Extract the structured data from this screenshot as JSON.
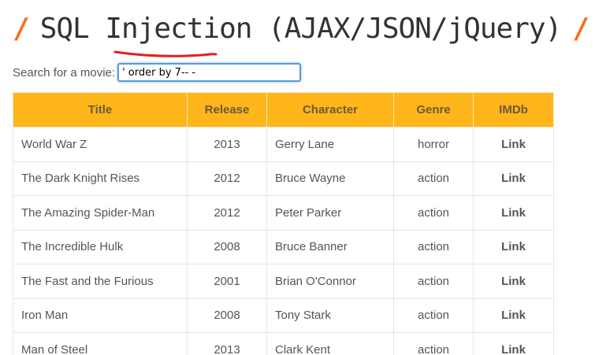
{
  "header": {
    "slash_left": "/",
    "title": "SQL Injection (AJAX/JSON/jQuery)",
    "slash_right": "/",
    "accent_color": "#ff6a14",
    "underline_color": "#e02020"
  },
  "search": {
    "label": "Search for a movie:",
    "value": "' order by 7-- -"
  },
  "table": {
    "header_color": "#ffb61a",
    "columns": [
      "Title",
      "Release",
      "Character",
      "Genre",
      "IMDb"
    ],
    "rows": [
      {
        "title": "World War Z",
        "release": "2013",
        "character": "Gerry Lane",
        "genre": "horror",
        "imdb": "Link"
      },
      {
        "title": "The Dark Knight Rises",
        "release": "2012",
        "character": "Bruce Wayne",
        "genre": "action",
        "imdb": "Link"
      },
      {
        "title": "The Amazing Spider-Man",
        "release": "2012",
        "character": "Peter Parker",
        "genre": "action",
        "imdb": "Link"
      },
      {
        "title": "The Incredible Hulk",
        "release": "2008",
        "character": "Bruce Banner",
        "genre": "action",
        "imdb": "Link"
      },
      {
        "title": "The Fast and the Furious",
        "release": "2001",
        "character": "Brian O'Connor",
        "genre": "action",
        "imdb": "Link"
      },
      {
        "title": "Iron Man",
        "release": "2008",
        "character": "Tony Stark",
        "genre": "action",
        "imdb": "Link"
      },
      {
        "title": "Man of Steel",
        "release": "2013",
        "character": "Clark Kent",
        "genre": "action",
        "imdb": "Link"
      }
    ]
  }
}
